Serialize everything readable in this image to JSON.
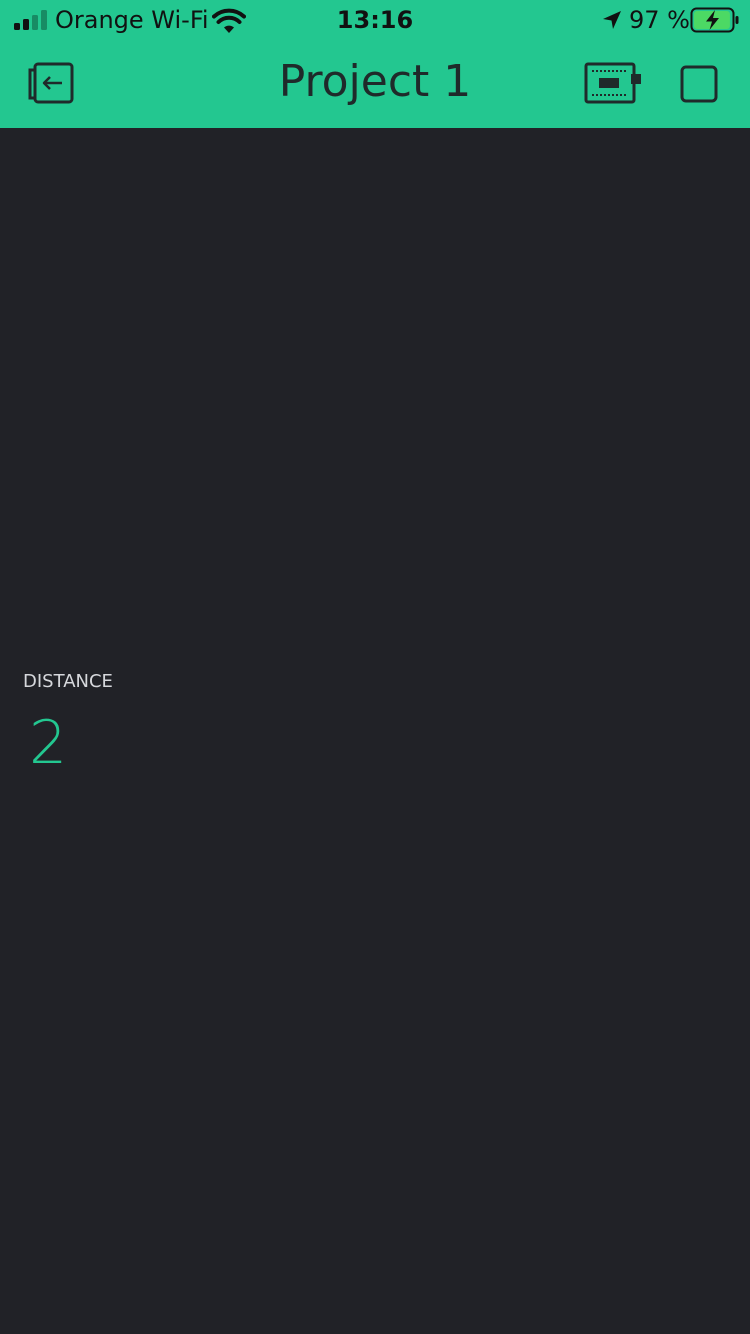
{
  "status_bar": {
    "carrier": "Orange Wi-Fi",
    "time": "13:16",
    "battery_percent": "97 %",
    "battery_level": 0.97,
    "signal_bars_filled": 2,
    "signal_bars_total": 4,
    "icons": [
      "signal-icon",
      "wifi-icon",
      "location-arrow-icon",
      "battery-charging-icon"
    ]
  },
  "nav": {
    "title": "Project 1",
    "left_icon": "exit-icon",
    "right_icons": [
      "device-board-icon",
      "stop-square-icon"
    ]
  },
  "widget": {
    "label": "DISTANCE",
    "value": "2"
  },
  "colors": {
    "accent": "#23c790",
    "background": "#212227",
    "label": "#d6d8dc",
    "icon_dark": "#1f2a2a"
  }
}
